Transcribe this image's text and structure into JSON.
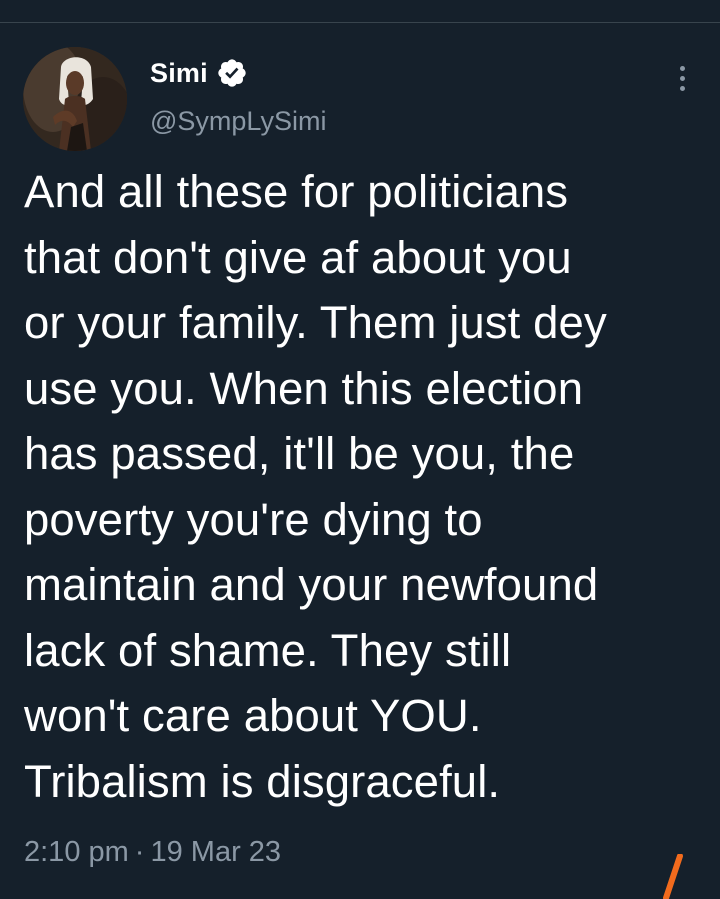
{
  "tweet": {
    "author": {
      "display_name": "Simi",
      "handle": "@SympLySimi",
      "verified": true
    },
    "text": "And all these for politicians\nthat don't give af about you\nor your family. Them just dey\nuse you. When this election\nhas passed, it'll be you, the\npoverty you're dying to\nmaintain and your newfound\nlack of shame. They still\nwon't care about YOU.\nTribalism is disgraceful.",
    "time": "2:10 pm",
    "separator": "·",
    "date": "19 Mar 23"
  },
  "icons": {
    "verified": "verified-badge-icon",
    "more": "more-options-icon"
  },
  "colors": {
    "background": "#15202b",
    "text_primary": "#ffffff",
    "text_secondary": "#8b98a5",
    "divider": "#38444d",
    "accent_mark": "#f26b1d"
  }
}
